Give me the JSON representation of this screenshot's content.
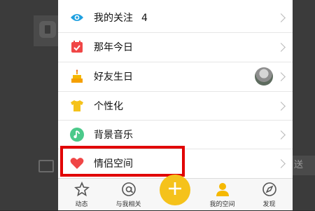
{
  "menu": {
    "items": [
      {
        "label": "我的关注",
        "count": "4",
        "icon": "eye-icon"
      },
      {
        "label": "那年今日",
        "icon": "calendar-check-icon"
      },
      {
        "label": "好友生日",
        "icon": "birthday-cake-icon"
      },
      {
        "label": "个性化",
        "icon": "tshirt-icon"
      },
      {
        "label": "背景音乐",
        "icon": "music-note-icon"
      },
      {
        "label": "情侣空间",
        "icon": "heart-icon"
      }
    ]
  },
  "background": {
    "send_label": "送"
  },
  "tabbar": {
    "tabs": [
      {
        "label": "动态",
        "icon": "star-icon"
      },
      {
        "label": "与我相关",
        "icon": "at-icon"
      },
      {
        "label": "",
        "icon": "plus-icon"
      },
      {
        "label": "我的空间",
        "icon": "person-icon"
      },
      {
        "label": "发现",
        "icon": "compass-icon"
      }
    ]
  },
  "colors": {
    "highlight": "#e10000",
    "plus_button": "#f5c21b",
    "profile_active": "#f5b800"
  }
}
